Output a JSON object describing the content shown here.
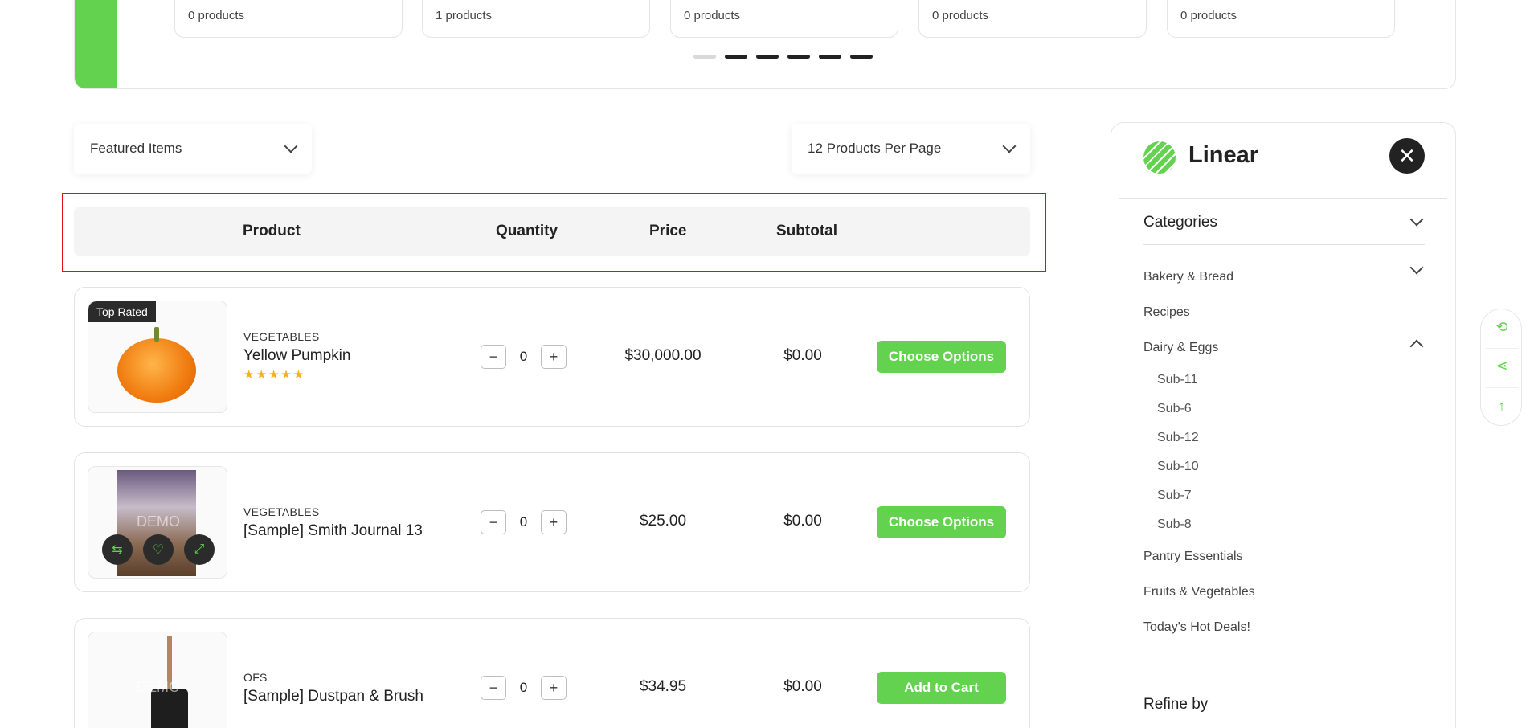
{
  "categories_carousel": {
    "cards": [
      "0 products",
      "1 products",
      "0 products",
      "0 products",
      "0 products"
    ]
  },
  "toolbar": {
    "sort_label": "Featured Items",
    "per_page_label": "12 Products Per Page"
  },
  "table": {
    "headers": [
      "Product",
      "Quantity",
      "Price",
      "Subtotal"
    ]
  },
  "products": [
    {
      "badge": "Top Rated",
      "category": "VEGETABLES",
      "name": "Yellow Pumpkin",
      "rating": "★★★★★",
      "quantity": "0",
      "price": "$30,000.00",
      "subtotal": "$0.00",
      "action": "Choose Options"
    },
    {
      "image_text": "DEMO",
      "category": "VEGETABLES",
      "name": "[Sample] Smith Journal 13",
      "quantity": "0",
      "price": "$25.00",
      "subtotal": "$0.00",
      "action": "Choose Options"
    },
    {
      "image_text": "DEMO",
      "category": "OFS",
      "name": "[Sample] Dustpan & Brush",
      "quantity": "0",
      "price": "$34.95",
      "subtotal": "$0.00",
      "action": "Add to Cart"
    }
  ],
  "qty_controls": {
    "minus": "−",
    "plus": "+"
  },
  "sidebar": {
    "brand": "Linear",
    "close": "✕",
    "categories_heading": "Categories",
    "items": [
      "Bakery & Bread",
      "Recipes",
      "Dairy & Eggs",
      "Pantry Essentials",
      "Fruits & Vegetables",
      "Today's Hot Deals!"
    ],
    "dairy_subs": [
      "Sub-11",
      "Sub-6",
      "Sub-12",
      "Sub-10",
      "Sub-7",
      "Sub-8"
    ],
    "refine_heading": "Refine by"
  },
  "colors": {
    "accent": "#63d24e",
    "dark": "#222222",
    "highlight": "#e0101b"
  }
}
